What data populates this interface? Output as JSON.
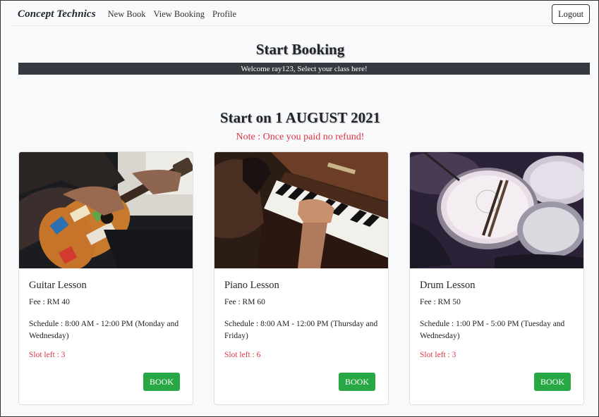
{
  "navbar": {
    "brand": "Concept Technics",
    "links": [
      "New Book",
      "View Booking",
      "Profile"
    ],
    "logout_label": "Logout"
  },
  "header": {
    "title": "Start Booking",
    "welcome": "Welcome ray123, Select your class here!"
  },
  "session": {
    "heading": "Start on 1 AUGUST 2021",
    "note": "Note : Once you paid no refund!"
  },
  "colors": {
    "danger": "#dc3545",
    "success": "#28a745",
    "dark_bar": "#343a40"
  },
  "cards": [
    {
      "title": "Guitar Lesson",
      "fee": "Fee : RM 40",
      "schedule": "Schedule : 8:00 AM - 12:00 PM (Monday and Wednesday)",
      "slot": "Slot left : 3",
      "button": "BOOK",
      "image": "guitar-photo"
    },
    {
      "title": "Piano Lesson",
      "fee": "Fee : RM 60",
      "schedule": "Schedule : 8:00 AM - 12:00 PM (Thursday and Friday)",
      "slot": "Slot left : 6",
      "button": "BOOK",
      "image": "piano-photo"
    },
    {
      "title": "Drum Lesson",
      "fee": "Fee : RM 50",
      "schedule": "Schedule : 1:00 PM - 5:00 PM (Tuesday and Wednesday)",
      "slot": "Slot left : 3",
      "button": "BOOK",
      "image": "drum-photo"
    }
  ]
}
